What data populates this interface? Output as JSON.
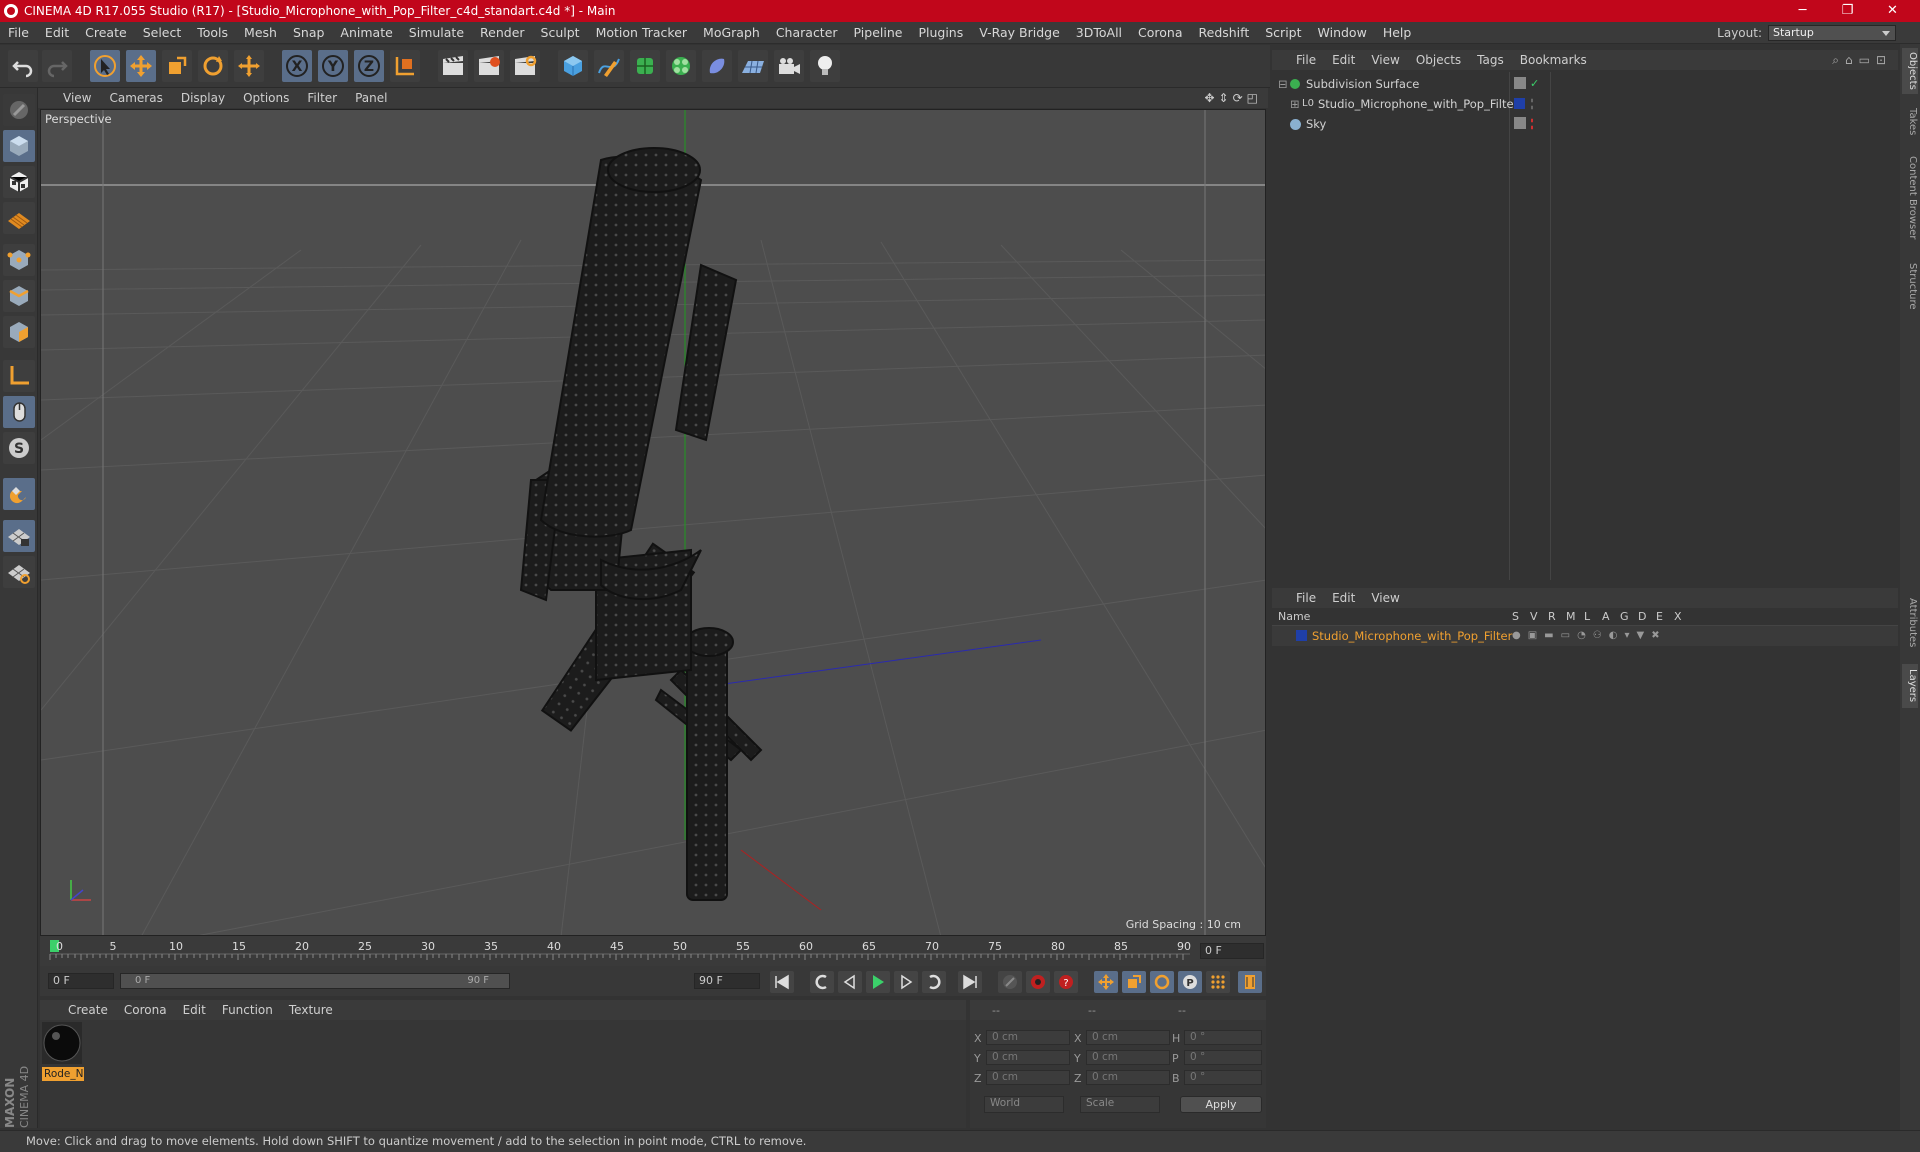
{
  "window": {
    "title": "CINEMA 4D R17.055 Studio (R17) - [Studio_Microphone_with_Pop_Filter_c4d_standart.c4d *] - Main",
    "minimize": "─",
    "maximize": "❐",
    "close": "✕"
  },
  "menu": [
    "File",
    "Edit",
    "Create",
    "Select",
    "Tools",
    "Mesh",
    "Snap",
    "Animate",
    "Simulate",
    "Render",
    "Sculpt",
    "Motion Tracker",
    "MoGraph",
    "Character",
    "Pipeline",
    "Plugins",
    "V-Ray Bridge",
    "3DToAll",
    "Corona",
    "Redshift",
    "Script",
    "Window",
    "Help"
  ],
  "layout": {
    "label": "Layout:",
    "value": "Startup"
  },
  "viewport": {
    "menu": [
      "View",
      "Cameras",
      "Display",
      "Options",
      "Filter",
      "Panel"
    ],
    "camera": "Perspective",
    "grid_spacing": "Grid Spacing : 10 cm"
  },
  "timeline": {
    "ticks": [
      "0",
      "5",
      "10",
      "15",
      "20",
      "25",
      "30",
      "35",
      "40",
      "45",
      "50",
      "55",
      "60",
      "65",
      "70",
      "75",
      "80",
      "85",
      "90"
    ],
    "current_frame": "0 F",
    "start_field": "0 F",
    "slider_start": "0 F",
    "slider_end": "90 F",
    "end_field": "90 F"
  },
  "materials": {
    "menu": [
      "Create",
      "Corona",
      "Edit",
      "Function",
      "Texture"
    ],
    "items": [
      {
        "name": "Rode_N"
      }
    ]
  },
  "coordinates": {
    "headers": [
      "--",
      "--",
      "--"
    ],
    "rows": [
      {
        "l1": "X",
        "v1": "0 cm",
        "l2": "X",
        "v2": "0 cm",
        "l3": "H",
        "v3": "0 °"
      },
      {
        "l1": "Y",
        "v1": "0 cm",
        "l2": "Y",
        "v2": "0 cm",
        "l3": "P",
        "v3": "0 °"
      },
      {
        "l1": "Z",
        "v1": "0 cm",
        "l2": "Z",
        "v2": "0 cm",
        "l3": "B",
        "v3": "0 °"
      }
    ],
    "mode": "World",
    "scale": "Scale",
    "apply": "Apply"
  },
  "objects": {
    "menu": [
      "File",
      "Edit",
      "View",
      "Objects",
      "Tags",
      "Bookmarks"
    ],
    "items": [
      {
        "name": "Subdivision Surface"
      },
      {
        "name": "Studio_Microphone_with_Pop_Filter"
      },
      {
        "name": "Sky"
      }
    ]
  },
  "layers": {
    "menu": [
      "File",
      "Edit",
      "View"
    ],
    "header_name": "Name",
    "columns": [
      "S",
      "V",
      "R",
      "M",
      "L",
      "A",
      "G",
      "D",
      "E",
      "X"
    ],
    "items": [
      {
        "name": "Studio_Microphone_with_Pop_Filter"
      }
    ]
  },
  "right_tabs": [
    "Objects",
    "Takes",
    "Content Browser",
    "Structure",
    "Attributes",
    "Layers"
  ],
  "status": "Move: Click and drag to move elements. Hold down SHIFT to quantize movement / add to the selection in point mode, CTRL to remove.",
  "colors": {
    "title_bar": "#c1061b",
    "accent_orange": "#f0a030",
    "layer_blue": "#1f3fa8",
    "selection": "#5a6e8a"
  }
}
